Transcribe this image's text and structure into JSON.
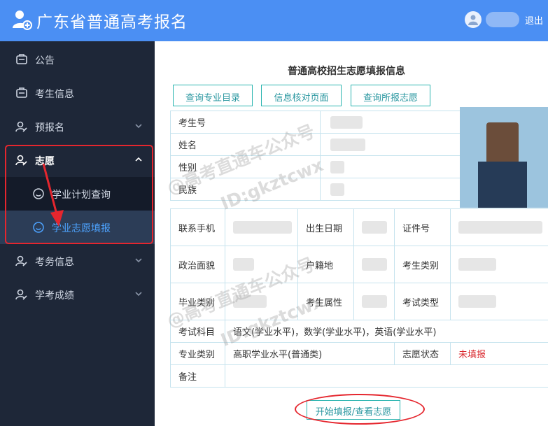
{
  "header": {
    "title": "广东省普通高考报名",
    "logout_label": "退出"
  },
  "sidebar": {
    "items": [
      {
        "label": "公告"
      },
      {
        "label": "考生信息"
      },
      {
        "label": "预报名"
      },
      {
        "label": "志愿"
      },
      {
        "label": "学业计划查询"
      },
      {
        "label": "学业志愿填报"
      },
      {
        "label": "考务信息"
      },
      {
        "label": "学考成绩"
      }
    ]
  },
  "main": {
    "title": "普通高校招生志愿填报信息",
    "buttons": [
      "查询专业目录",
      "信息核对页面",
      "查询所报志愿"
    ],
    "basic_info": {
      "exam_number_label": "考生号",
      "name_label": "姓名",
      "gender_label": "性别",
      "ethnicity_label": "民族"
    },
    "detail": {
      "phone_label": "联系手机",
      "birth_label": "出生日期",
      "id_label": "证件号",
      "politics_label": "政治面貌",
      "household_label": "户籍地",
      "candidate_type_label": "考生类别",
      "graduate_type_label": "毕业类别",
      "candidate_attr_label": "考生属性",
      "exam_type_label": "考试类型",
      "subjects_label": "考试科目",
      "subjects_value": "语文(学业水平)，数学(学业水平)，英语(学业水平)",
      "major_type_label": "专业类别",
      "major_type_value": "高职学业水平(普通类)",
      "wish_status_label": "志愿状态",
      "wish_status_value": "未填报",
      "remark_label": "备注"
    },
    "start_button": "开始填报/查看志愿",
    "status_color": "#d9282e"
  },
  "watermarks": [
    "@高考直通车公众号",
    "ID:gkztcwx",
    "@高考直通车公众号",
    "ID:gkztcwx"
  ],
  "colors": {
    "topbar": "#4b8ff3",
    "sidebar": "#1e2738",
    "accent_teal": "#2bb5b0",
    "annotation_red": "#e5262e"
  }
}
